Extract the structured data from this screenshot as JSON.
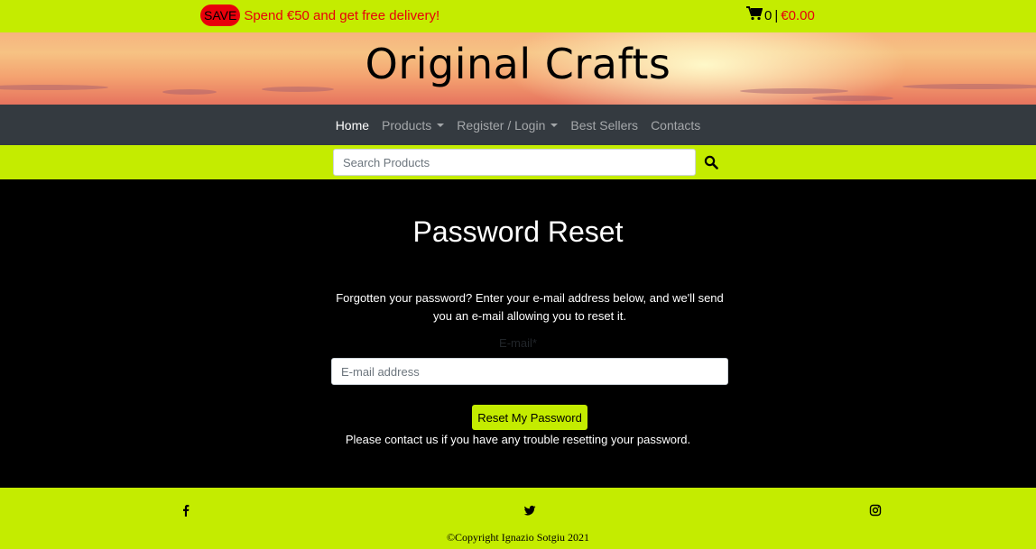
{
  "promo": {
    "badge": "SAVE",
    "text": "Spend €50 and get free delivery!"
  },
  "cart": {
    "count": "0",
    "separator": "|",
    "total": "€0.00"
  },
  "site": {
    "title": "Original Crafts"
  },
  "nav": {
    "items": [
      {
        "label": "Home"
      },
      {
        "label": "Products"
      },
      {
        "label": "Register / Login"
      },
      {
        "label": "Best Sellers"
      },
      {
        "label": "Contacts"
      }
    ]
  },
  "search": {
    "placeholder": "Search Products"
  },
  "reset": {
    "title": "Password Reset",
    "instructions": "Forgotten your password? Enter your e-mail address below, and we'll send you an e-mail allowing you to reset it.",
    "email_label": "E-mail*",
    "email_placeholder": "E-mail address",
    "button": "Reset My Password",
    "help": "Please contact us if you have any trouble resetting your password."
  },
  "footer": {
    "copyright": "©Copyright Ignazio Sotgiu 2021"
  },
  "colors": {
    "accent": "#c4ec00",
    "alert": "#e8000b",
    "navbar": "#343a40"
  }
}
